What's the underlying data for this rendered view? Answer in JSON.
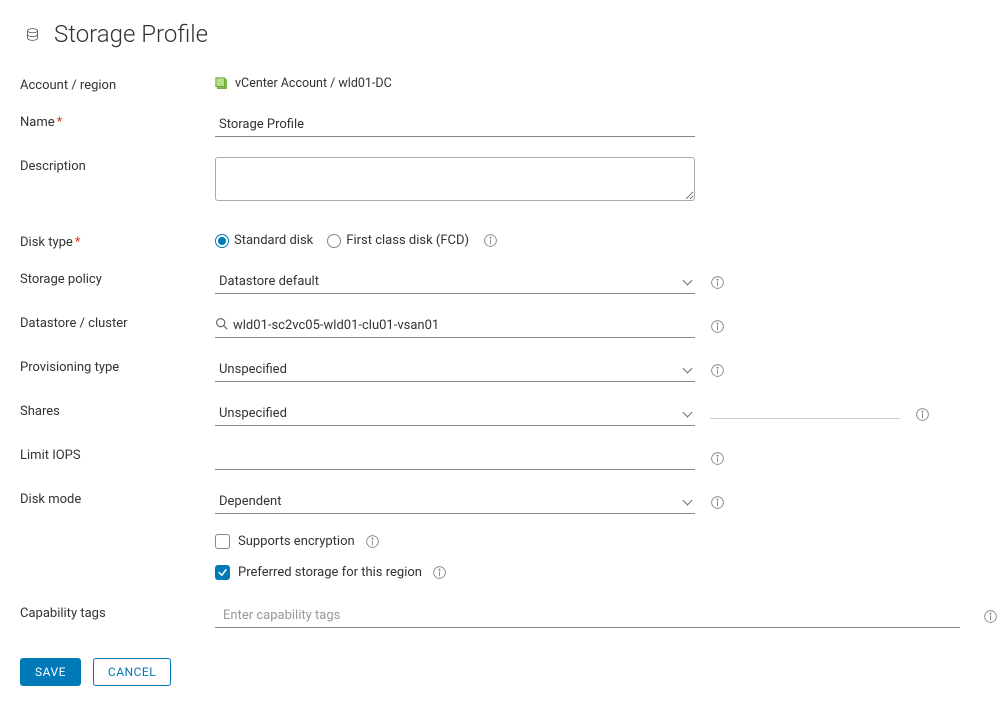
{
  "page": {
    "title": "Storage Profile"
  },
  "labels": {
    "account_region": "Account / region",
    "name": "Name",
    "description": "Description",
    "disk_type": "Disk type",
    "storage_policy": "Storage policy",
    "datastore_cluster": "Datastore / cluster",
    "provisioning_type": "Provisioning type",
    "shares": "Shares",
    "limit_iops": "Limit IOPS",
    "disk_mode": "Disk mode",
    "capability_tags": "Capability tags"
  },
  "values": {
    "account_region": "vCenter Account / wld01-DC",
    "name": "Storage Profile",
    "description": "",
    "storage_policy": "Datastore default",
    "datastore_cluster": "wld01-sc2vc05-wld01-clu01-vsan01",
    "provisioning_type": "Unspecified",
    "shares": "Unspecified",
    "limit_iops": "",
    "disk_mode": "Dependent",
    "capability_tags": ""
  },
  "placeholders": {
    "capability_tags": "Enter capability tags"
  },
  "disk_type_options": {
    "standard": "Standard disk",
    "fcd": "First class disk (FCD)"
  },
  "checkboxes": {
    "supports_encryption": "Supports encryption",
    "preferred_storage": "Preferred storage for this region"
  },
  "buttons": {
    "save": "SAVE",
    "cancel": "CANCEL"
  }
}
